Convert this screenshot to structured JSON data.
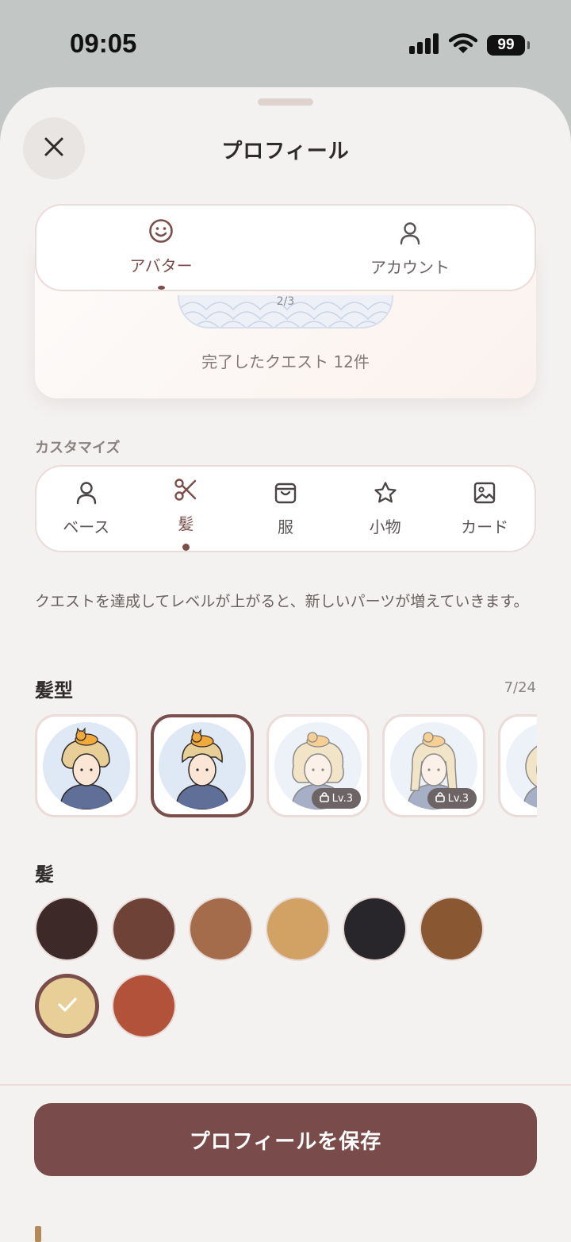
{
  "status_bar": {
    "time": "09:05",
    "battery": "99",
    "icons": [
      "signal-icon",
      "wifi-icon"
    ]
  },
  "header": {
    "title": "プロフィール",
    "close_icon": "close-icon"
  },
  "main_tabs": [
    {
      "label": "アバター",
      "icon": "smile-icon",
      "active": true
    },
    {
      "label": "アカウント",
      "icon": "user-icon",
      "active": false
    }
  ],
  "preview": {
    "badge_progress": "2/3",
    "quest_count": "完了したクエスト 12件"
  },
  "customize": {
    "section_label": "カスタマイズ",
    "tabs": [
      {
        "label": "ベース",
        "icon": "user-icon",
        "active": false
      },
      {
        "label": "髪",
        "icon": "scissors-icon",
        "active": true
      },
      {
        "label": "服",
        "icon": "bag-icon",
        "active": false
      },
      {
        "label": "小物",
        "icon": "star-icon",
        "active": false
      },
      {
        "label": "カード",
        "icon": "image-icon",
        "active": false
      }
    ]
  },
  "hint": "クエストを達成してレベルが上がると、新しいパーツが増えていきます。",
  "hair_style": {
    "title": "髪型",
    "count": "7/24",
    "items": [
      {
        "selected": false,
        "locked": false,
        "hair_color": "#e8cf98"
      },
      {
        "selected": true,
        "locked": false,
        "hair_color": "#e8cf98"
      },
      {
        "selected": false,
        "locked": true,
        "lock_label": "Lv.3",
        "hair_color": "#e8cf98"
      },
      {
        "selected": false,
        "locked": true,
        "lock_label": "Lv.3",
        "hair_color": "#e8cf98"
      },
      {
        "selected": false,
        "locked": false,
        "hair_color": "#e8cf98"
      }
    ]
  },
  "hair_color": {
    "title": "髪",
    "swatches": [
      {
        "color": "#3d2a28",
        "selected": false
      },
      {
        "color": "#6e4237",
        "selected": false
      },
      {
        "color": "#a56c4c",
        "selected": false
      },
      {
        "color": "#d2a164",
        "selected": false
      },
      {
        "color": "#28262a",
        "selected": false
      },
      {
        "color": "#8a5733",
        "selected": false
      },
      {
        "color": "#e8cf98",
        "selected": true
      },
      {
        "color": "#b2523b",
        "selected": false
      }
    ]
  },
  "footer": {
    "save_label": "プロフィールを保存"
  },
  "colors": {
    "accent": "#7a4b4b",
    "sheet_bg": "#f4f2f1"
  }
}
